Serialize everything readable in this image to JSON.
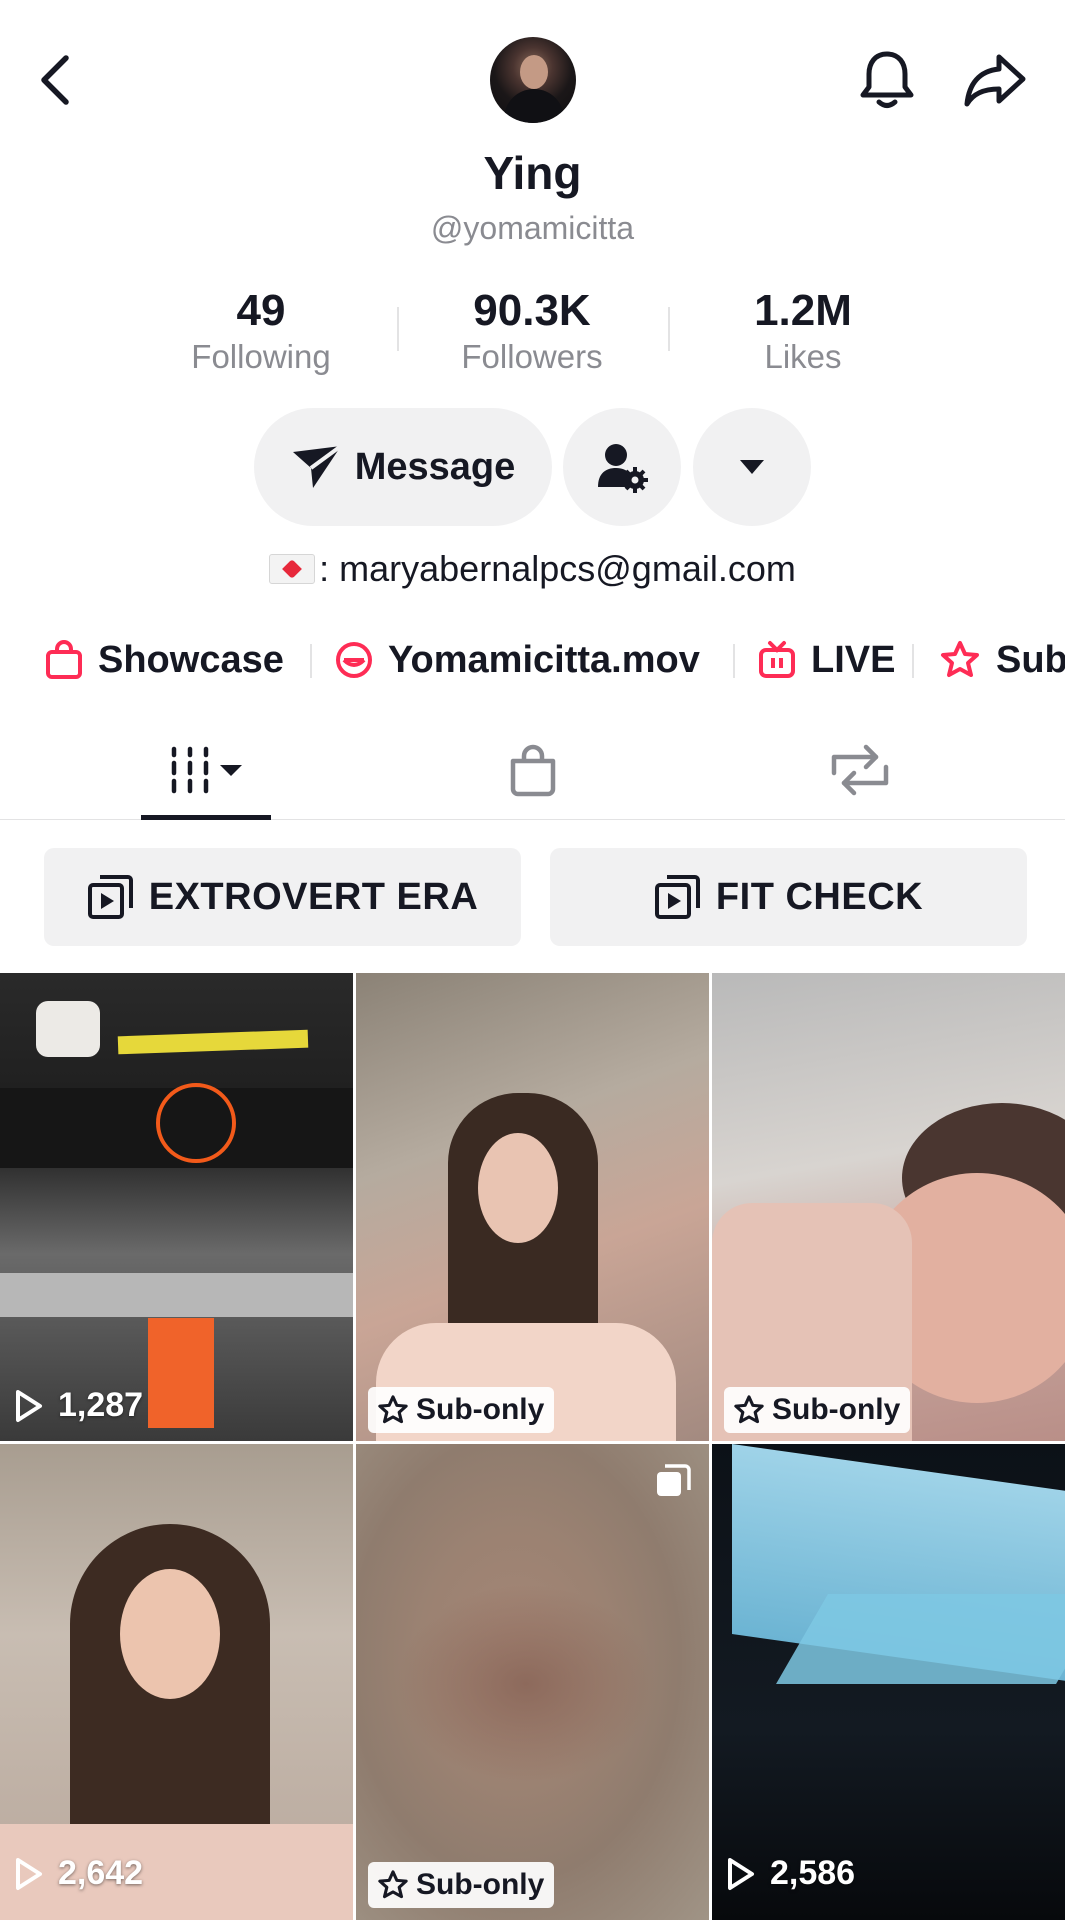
{
  "profile": {
    "display_name": "Ying",
    "username": "@yomamicitta",
    "bio": ": maryabernalpcs@gmail.com"
  },
  "stats": [
    {
      "value": "49",
      "label": "Following"
    },
    {
      "value": "90.3K",
      "label": "Followers"
    },
    {
      "value": "1.2M",
      "label": "Likes"
    }
  ],
  "actions": {
    "message_label": "Message"
  },
  "links": [
    {
      "label": "Showcase",
      "icon": "shopping-bag-icon"
    },
    {
      "label": "Yomamicitta.mov",
      "icon": "lemon8-icon"
    },
    {
      "label": "LIVE",
      "icon": "tv-icon"
    },
    {
      "label": "Sub",
      "icon": "star-hand-icon"
    }
  ],
  "tabs": [
    "videos-grid-icon",
    "shop-bag-icon",
    "repost-icon"
  ],
  "playlists": [
    {
      "label": "EXTROVERT ERA"
    },
    {
      "label": "FIT CHECK"
    }
  ],
  "videos": [
    {
      "views": "1,287",
      "badge": ""
    },
    {
      "views": "",
      "badge": "Sub-only"
    },
    {
      "views": "",
      "badge": "Sub-only"
    },
    {
      "views": "2,642",
      "badge": ""
    },
    {
      "views": "",
      "badge": "Sub-only"
    },
    {
      "views": "2,586",
      "badge": ""
    }
  ],
  "colors": {
    "accent": "#fe2c55",
    "text": "#161823",
    "muted": "#8a8b91",
    "pill_bg": "#f1f1f2"
  }
}
